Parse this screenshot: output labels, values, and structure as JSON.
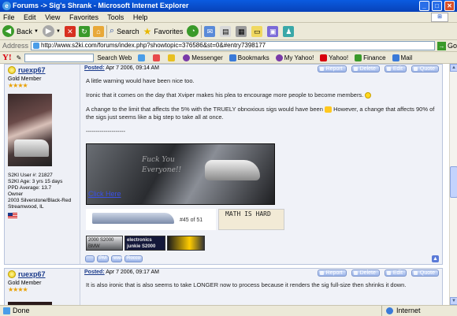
{
  "window": {
    "title": "Forums -> Sig's Shrank - Microsoft Internet Explorer",
    "minimize": "_",
    "maximize": "□",
    "close": "✕"
  },
  "menu": [
    "File",
    "Edit",
    "View",
    "Favorites",
    "Tools",
    "Help"
  ],
  "toolbar": {
    "back": "Back",
    "search": "Search",
    "favorites": "Favorites"
  },
  "address": {
    "label": "Address",
    "url": "http://www.s2ki.com/forums/index.php?showtopic=376586&st=0&#entry7398177",
    "go": "Go"
  },
  "yahoo": {
    "logo": "Y!",
    "search_web": "Search Web",
    "messenger": "Messenger",
    "bookmarks": "Bookmarks",
    "my_yahoo": "My Yahoo!",
    "yahoo": "Yahoo!",
    "finance": "Finance",
    "mail": "Mail"
  },
  "posts": [
    {
      "username": "ruexp67",
      "rank": "Gold Member",
      "stars": "★★★★",
      "stats": [
        "S2KI User #: 21827",
        "S2KI Age: 3 yrs 15 days",
        "PPD Average: 13.7",
        "Owner",
        "2003 Silverstone/Black-Red",
        "Streamwood, IL"
      ],
      "posted_label": "Posted:",
      "posted_date": "Apr 7 2006, 09:14 AM",
      "buttons": [
        "Report",
        "Delete",
        "Edit",
        "Quote"
      ],
      "paragraphs": [
        "A little warning would have been nice too.",
        "Ironic that it comes on the day that Xviper makes his plea to encourage more people to become members.",
        "A change to the limit that affects the 5% with the TRUELY obnoxious sigs would have been",
        "However, a change that affects 90% of the sigs just seems like a big step to take all at once."
      ],
      "sig_divider": "--------------------",
      "sig_script": "Fuck You\nEveryone!!",
      "click_here": "Click Here",
      "counter": "#45 of 51",
      "math_text": "MATH IS HARD",
      "badges": [
        "2000 S2000 BMW",
        "electronics junkie S2000",
        ""
      ],
      "footer": [
        "PM",
        "www",
        "Rocco"
      ]
    },
    {
      "username": "ruexp67",
      "rank": "Gold Member",
      "stars": "★★★★",
      "posted_label": "Posted:",
      "posted_date": "Apr 7 2006, 09:17 AM",
      "buttons": [
        "Report",
        "Delete",
        "Edit",
        "Quote"
      ],
      "body": "It is also ironic that is also seems to take LONGER now to process because it renders the sig full-size then shrinks it down."
    }
  ],
  "status": {
    "left": "Done",
    "zone": "Internet"
  }
}
